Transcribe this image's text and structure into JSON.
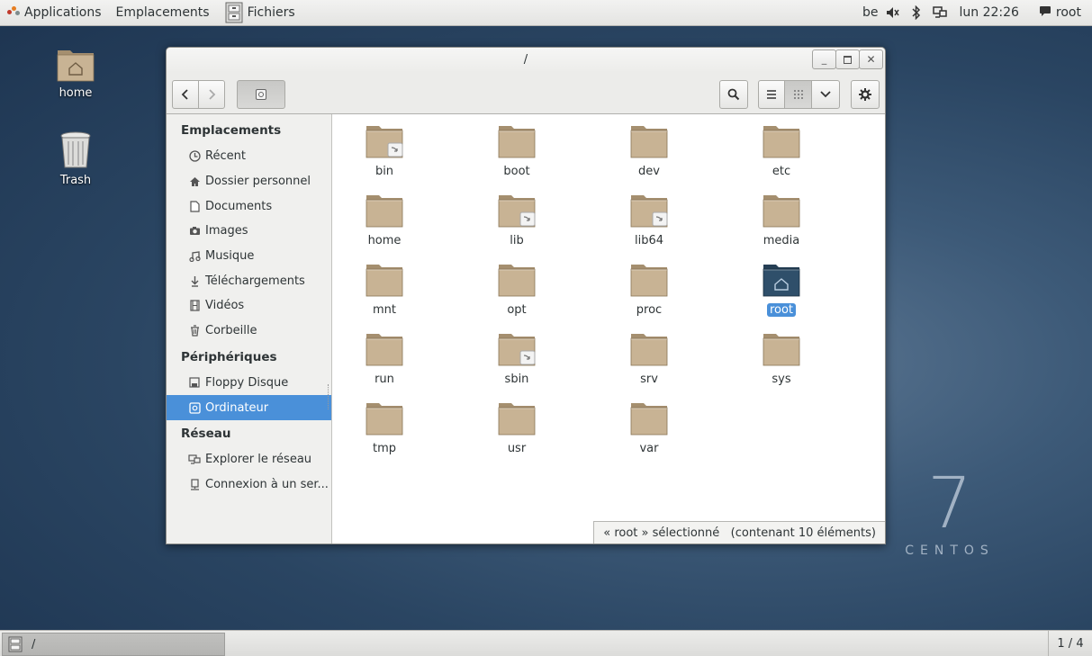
{
  "topbar": {
    "applications": "Applications",
    "places": "Emplacements",
    "files": "Fichiers",
    "keyboard": "be",
    "clock": "lun 22:26",
    "user": "root"
  },
  "desktop": {
    "home": "home",
    "trash": "Trash"
  },
  "window": {
    "title": "/",
    "sidebar": {
      "sections": [
        {
          "title": "Emplacements"
        },
        {
          "title": "Périphériques"
        },
        {
          "title": "Réseau"
        }
      ],
      "places": [
        {
          "label": "Récent",
          "icon": "clock-icon"
        },
        {
          "label": "Dossier personnel",
          "icon": "home-icon"
        },
        {
          "label": "Documents",
          "icon": "document-icon"
        },
        {
          "label": "Images",
          "icon": "camera-icon"
        },
        {
          "label": "Musique",
          "icon": "music-icon"
        },
        {
          "label": "Téléchargements",
          "icon": "download-icon"
        },
        {
          "label": "Vidéos",
          "icon": "film-icon"
        },
        {
          "label": "Corbeille",
          "icon": "trash-icon"
        }
      ],
      "devices": [
        {
          "label": "Floppy Disque",
          "icon": "floppy-icon"
        },
        {
          "label": "Ordinateur",
          "icon": "computer-icon"
        }
      ],
      "network": [
        {
          "label": "Explorer le réseau",
          "icon": "network-icon"
        },
        {
          "label": "Connexion à un ser...",
          "icon": "server-icon"
        }
      ]
    },
    "files": [
      {
        "name": "bin",
        "link": true
      },
      {
        "name": "boot",
        "link": false
      },
      {
        "name": "dev",
        "link": false
      },
      {
        "name": "etc",
        "link": false
      },
      {
        "name": "home",
        "link": false
      },
      {
        "name": "lib",
        "link": true
      },
      {
        "name": "lib64",
        "link": true
      },
      {
        "name": "media",
        "link": false
      },
      {
        "name": "mnt",
        "link": false
      },
      {
        "name": "opt",
        "link": false
      },
      {
        "name": "proc",
        "link": false
      },
      {
        "name": "root",
        "link": false,
        "selected": true
      },
      {
        "name": "run",
        "link": false
      },
      {
        "name": "sbin",
        "link": true
      },
      {
        "name": "srv",
        "link": false
      },
      {
        "name": "sys",
        "link": false
      },
      {
        "name": "tmp",
        "link": false
      },
      {
        "name": "usr",
        "link": false
      },
      {
        "name": "var",
        "link": false
      }
    ],
    "status": "« root » sélectionné   (contenant 10 éléments)"
  },
  "taskbar": {
    "task": "/",
    "pager": "1 / 4"
  },
  "branding": {
    "number": "7",
    "word": "CENTOS"
  },
  "colors": {
    "selection": "#4a90d9",
    "folder": "#c8b394",
    "folder_selected": "#2f4f6a"
  }
}
